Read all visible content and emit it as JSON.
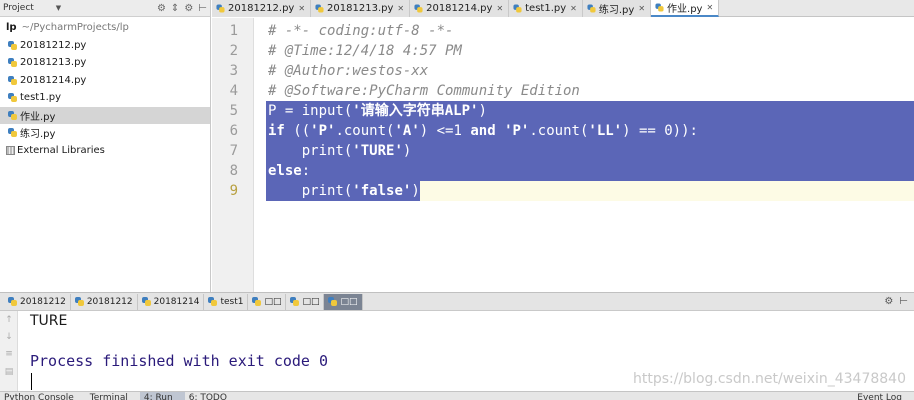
{
  "project_panel": {
    "title": "Project",
    "root": {
      "name": "lp",
      "path": "~/PycharmProjects/lp"
    },
    "files": [
      "20181212.py",
      "20181213.py",
      "20181214.py",
      "test1.py",
      "作业.py",
      "练习.py"
    ],
    "selected_index": 4,
    "external": "External Libraries"
  },
  "editor_tabs": [
    {
      "label": "20181212.py",
      "active": false
    },
    {
      "label": "20181213.py",
      "active": false
    },
    {
      "label": "20181214.py",
      "active": false
    },
    {
      "label": "test1.py",
      "active": false
    },
    {
      "label": "练习.py",
      "active": false
    },
    {
      "label": "作业.py",
      "active": true
    }
  ],
  "editor": {
    "line_numbers": [
      "1",
      "2",
      "3",
      "4",
      "5",
      "6",
      "7",
      "8",
      "9"
    ],
    "comments": [
      "# -*- coding:utf-8 -*-",
      "# @Time:12/4/18 4:57 PM",
      "# @Author:westos-xx",
      "# @Software:PyCharm Community Edition"
    ],
    "code": {
      "l5_a": "P = input(",
      "l5_str": "'请输入字符串ALP'",
      "l5_b": ")",
      "l6_if": "if",
      "l6_a": " ((",
      "l6_s1": "'P'",
      "l6_b": ".count(",
      "l6_s2": "'A'",
      "l6_c": ") <=1 ",
      "l6_and": "and",
      "l6_d": " ",
      "l6_s3": "'P'",
      "l6_e": ".count(",
      "l6_s4": "'LL'",
      "l6_f": ") == 0)):",
      "l7_a": "    print(",
      "l7_str": "'TURE'",
      "l7_b": ")",
      "l8_else": "else",
      "l8_a": ":",
      "l9_a": "    print(",
      "l9_str": "'false'",
      "l9_b": ")"
    }
  },
  "run_tabs": [
    {
      "label": "20181212",
      "active": false
    },
    {
      "label": "20181212",
      "active": false
    },
    {
      "label": "20181214",
      "active": false
    },
    {
      "label": "test1",
      "active": false
    },
    {
      "label": "□□",
      "active": false
    },
    {
      "label": "□□",
      "active": false
    },
    {
      "label": "□□",
      "active": true
    }
  ],
  "console": {
    "output_line": "TURE",
    "exit_message": "Process finished with exit code 0",
    "watermark": "https://blog.csdn.net/weixin_43478840"
  },
  "bottom_bar": [
    "Python Console",
    "Terminal",
    "4: Run",
    "6: TODO",
    "Event Log"
  ],
  "colors": {
    "selection": "#5b66b7",
    "comment": "#8a8a8a",
    "exit_text": "#2a1a7a"
  }
}
